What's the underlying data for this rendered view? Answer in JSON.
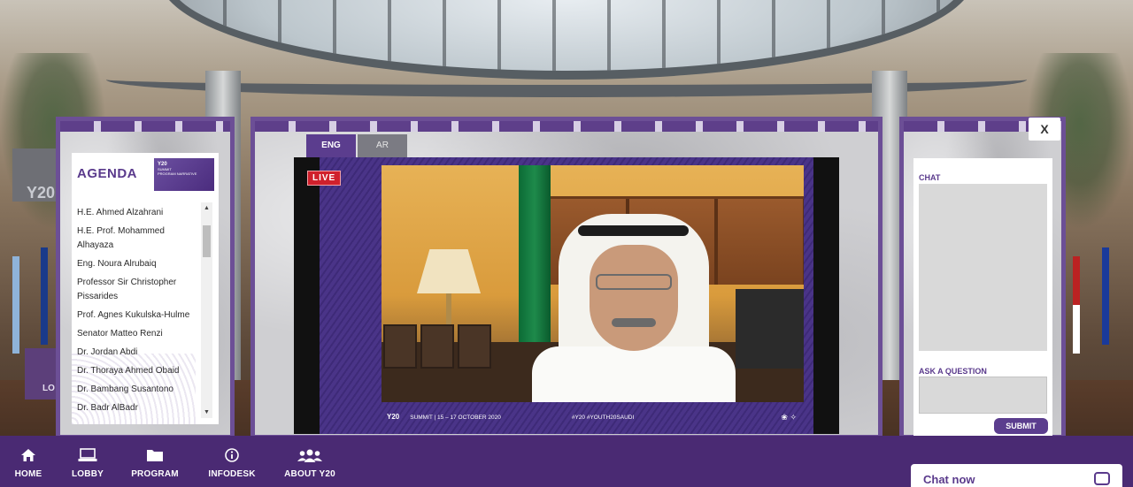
{
  "agenda": {
    "title": "AGENDA",
    "logo_text": "Y20",
    "logo_sub": "SUMMIT",
    "logo_program": "PROGRAM NARRATIVE",
    "items": [
      "H.E. Ahmed Alzahrani",
      "H.E. Prof. Mohammed Alhayaza",
      "Eng. Noura Alrubaiq",
      "Professor Sir Christopher Pissarides",
      "Prof. Agnes Kukulska-Hulme",
      "Senator Matteo Renzi",
      "Dr. Jordan Abdi",
      "Dr. Thoraya Ahmed Obaid",
      "Dr. Bambang Susantono",
      "Dr. Badr AlBadr"
    ]
  },
  "tabs": {
    "eng": "ENG",
    "ar": "AR"
  },
  "video": {
    "live": "LIVE",
    "footer_logo": "Y20",
    "footer_summit": "SUMMIT | 15 – 17 OCTOBER 2020",
    "footer_tags": "#Y20   #YOUTH20SAUDI"
  },
  "chat": {
    "label": "CHAT",
    "ask_label": "ASK A QUESTION",
    "submit": "SUBMIT",
    "close": "X"
  },
  "background": {
    "sign": "Y20",
    "left_sign": "LO"
  },
  "nav": {
    "items": [
      {
        "label": "HOME",
        "icon": "home-icon"
      },
      {
        "label": "LOBBY",
        "icon": "laptop-icon"
      },
      {
        "label": "PROGRAM",
        "icon": "folder-icon"
      },
      {
        "label": "INFODESK",
        "icon": "info-icon"
      },
      {
        "label": "ABOUT Y20",
        "icon": "users-icon"
      }
    ]
  },
  "chat_now": "Chat now",
  "colors": {
    "brand_purple": "#4a2a73",
    "accent_purple": "#5b3d8e",
    "live_red": "#d0202c"
  }
}
